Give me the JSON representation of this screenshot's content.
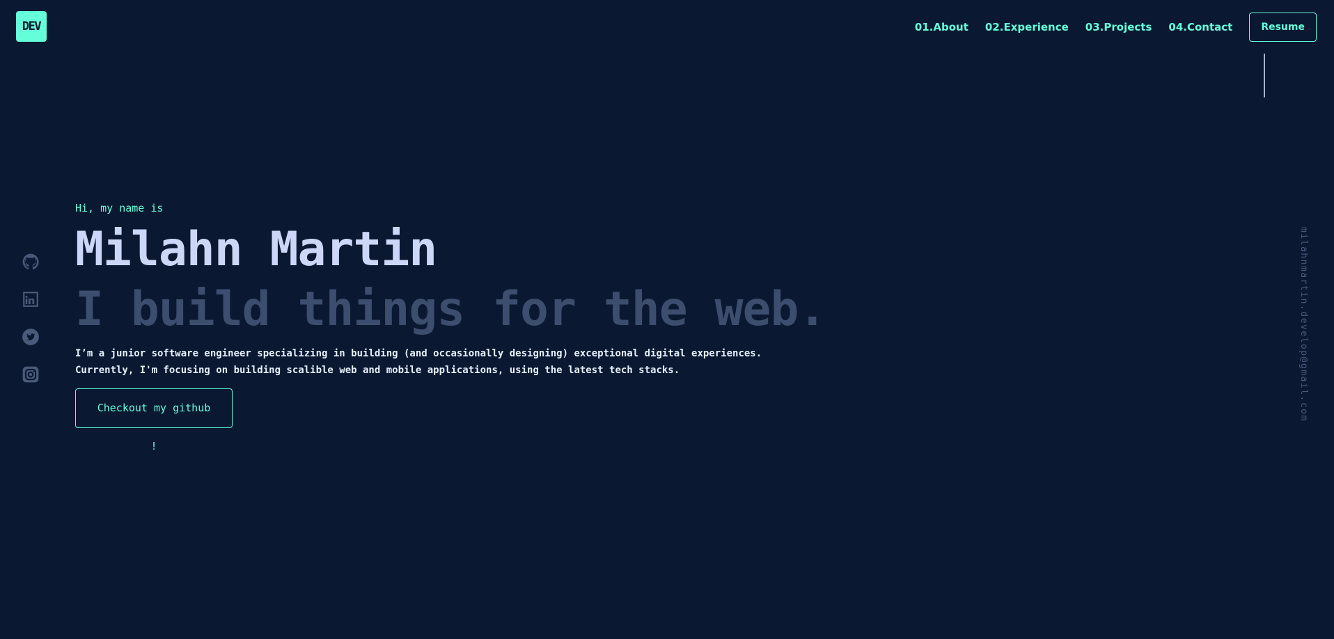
{
  "brand": {
    "logo_text": "DEV"
  },
  "nav": {
    "items": [
      {
        "num": "01.",
        "label": "About"
      },
      {
        "num": "02.",
        "label": "Experience"
      },
      {
        "num": "03.",
        "label": "Projects"
      },
      {
        "num": "04.",
        "label": "Contact"
      }
    ],
    "resume_label": "Resume"
  },
  "hero": {
    "greeting": "Hi, my name is",
    "name": "Milahn Martin",
    "tagline": "I build things for the web.",
    "description_line1": "I’m a junior software engineer specializing in building (and occasionally designing) exceptional digital experiences.",
    "description_line2": "Currently, I'm focusing on building scalible web and mobile applications, using the latest tech stacks.",
    "cta_label": "Checkout my github !"
  },
  "social": {
    "icons": [
      "github-icon",
      "linkedin-icon",
      "twitter-icon",
      "instagram-icon"
    ]
  },
  "email": "milahnmartin.develop@gmail.com",
  "colors": {
    "background": "#0b1831",
    "accent": "#64ffda",
    "heading": "#ccd6f6",
    "tagline": "#3c4d6d",
    "icon": "#4a5a7a"
  }
}
